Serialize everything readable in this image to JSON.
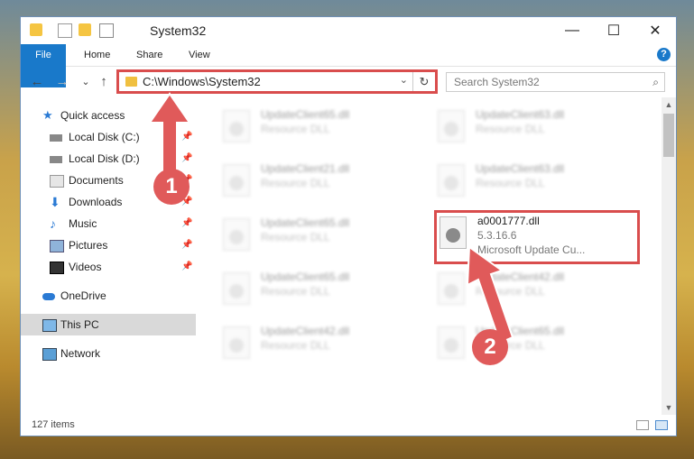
{
  "window": {
    "title": "System32",
    "minimize": "—",
    "maximize": "☐",
    "close": "✕"
  },
  "ribbon": {
    "tabs": [
      "File",
      "Home",
      "Share",
      "View"
    ],
    "help": "?"
  },
  "nav": {
    "back": "←",
    "forward": "→",
    "recent": "⌄",
    "up": "↑"
  },
  "address": {
    "path": "C:\\Windows\\System32",
    "dropdown": "⌄",
    "refresh": "↻"
  },
  "search": {
    "placeholder": "Search System32",
    "icon": "⌕"
  },
  "sidebar": {
    "items": [
      {
        "label": "Quick access",
        "icon": "star-icon",
        "pinned": false
      },
      {
        "label": "Local Disk (C:)",
        "icon": "drive-icon",
        "pinned": true
      },
      {
        "label": "Local Disk (D:)",
        "icon": "drive-icon",
        "pinned": true
      },
      {
        "label": "Documents",
        "icon": "documents-icon",
        "pinned": true
      },
      {
        "label": "Downloads",
        "icon": "download-icon",
        "pinned": true
      },
      {
        "label": "Music",
        "icon": "music-icon",
        "pinned": true
      },
      {
        "label": "Pictures",
        "icon": "pictures-icon",
        "pinned": true
      },
      {
        "label": "Videos",
        "icon": "videos-icon",
        "pinned": true
      },
      {
        "label": "OneDrive",
        "icon": "cloud-icon",
        "pinned": false
      },
      {
        "label": "This PC",
        "icon": "computer-icon",
        "pinned": false,
        "selected": true
      },
      {
        "label": "Network",
        "icon": "network-icon",
        "pinned": false
      }
    ],
    "pin_glyph": "📌"
  },
  "files": [
    {
      "name": "UpdateClient65.dll",
      "type": "Resource DLL"
    },
    {
      "name": "UpdateClient63.dll",
      "type": "Resource DLL"
    },
    {
      "name": "UpdateClient21.dll",
      "type": "Resource DLL"
    },
    {
      "name": "UpdateClient63.dll",
      "type": "Resource DLL"
    },
    {
      "name": "UpdateClient65.dll",
      "type": "Resource DLL"
    },
    {
      "name": "a0001777.dll",
      "version": "5.3.16.6",
      "type": "Microsoft Update Cu..."
    },
    {
      "name": "UpdateClient65.dll",
      "type": "Resource DLL"
    },
    {
      "name": "UpdateClient42.dll",
      "type": "Resource DLL"
    },
    {
      "name": "UpdateClient42.dll",
      "type": "Resource DLL"
    },
    {
      "name": "UpdateClient65.dll",
      "type": "Resource DLL"
    }
  ],
  "status": {
    "count": "127 items"
  },
  "annotations": {
    "step1": "1",
    "step2": "2",
    "color": "#e05a5a"
  },
  "scroll": {
    "up": "▲",
    "down": "▼"
  }
}
